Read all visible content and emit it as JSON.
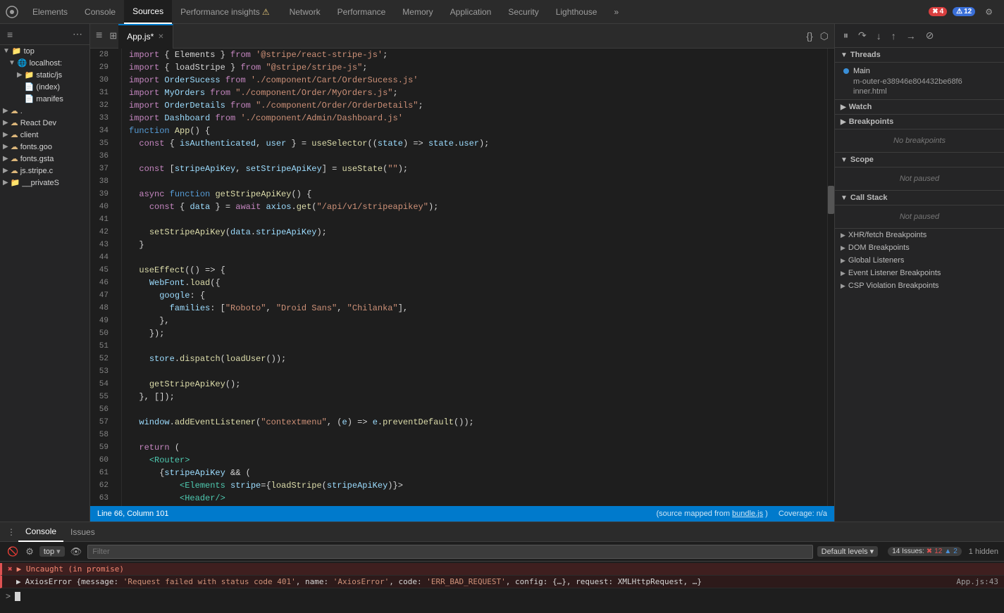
{
  "topnav": {
    "items": [
      {
        "label": "Elements",
        "active": false,
        "badge": null
      },
      {
        "label": "Console",
        "active": false,
        "badge": null
      },
      {
        "label": "Sources",
        "active": true,
        "badge": null
      },
      {
        "label": "Performance insights",
        "active": false,
        "badge": "warning",
        "icon": "⚠"
      },
      {
        "label": "Network",
        "active": false,
        "badge": null
      },
      {
        "label": "Performance",
        "active": false,
        "badge": null
      },
      {
        "label": "Memory",
        "active": false,
        "badge": null
      },
      {
        "label": "Application",
        "active": false,
        "badge": null
      },
      {
        "label": "Security",
        "active": false,
        "badge": null
      },
      {
        "label": "Lighthouse",
        "active": false,
        "badge": null
      },
      {
        "label": "»",
        "active": false,
        "badge": null
      }
    ],
    "error_badge": "4",
    "warning_badge": "12"
  },
  "sidebar": {
    "items": [
      {
        "label": "top",
        "indent": 0,
        "type": "folder",
        "expanded": true
      },
      {
        "label": "localhost:",
        "indent": 1,
        "type": "folder",
        "expanded": true
      },
      {
        "label": "static/js",
        "indent": 2,
        "type": "folder",
        "expanded": false
      },
      {
        "label": "(index)",
        "indent": 2,
        "type": "file",
        "active": false
      },
      {
        "label": "manifes",
        "indent": 2,
        "type": "file",
        "active": false
      },
      {
        "label": ".",
        "indent": 0,
        "type": "folder",
        "expanded": false
      },
      {
        "label": "React Dev",
        "indent": 0,
        "type": "folder",
        "expanded": false
      },
      {
        "label": "client",
        "indent": 0,
        "type": "folder",
        "expanded": false
      },
      {
        "label": "fonts.goo",
        "indent": 0,
        "type": "folder",
        "expanded": false
      },
      {
        "label": "fonts.gsta",
        "indent": 0,
        "type": "folder",
        "expanded": false
      },
      {
        "label": "js.stripe.c",
        "indent": 0,
        "type": "folder",
        "expanded": false
      },
      {
        "label": "__privateS",
        "indent": 0,
        "type": "folder",
        "expanded": false
      }
    ]
  },
  "editor": {
    "tabs": [
      {
        "label": "App.js*",
        "active": true,
        "modified": true
      }
    ],
    "lines": [
      {
        "num": 28,
        "code": "import { Elements } from '@stripe/react-stripe-js';",
        "tokens": [
          {
            "t": "kw",
            "v": "import"
          },
          {
            "t": "punct",
            "v": " { Elements } "
          },
          {
            "t": "kw",
            "v": "from"
          },
          {
            "t": "punct",
            "v": " "
          },
          {
            "t": "str",
            "v": "'@stripe/react-stripe-js'"
          },
          {
            "t": "punct",
            "v": ";"
          }
        ]
      },
      {
        "num": 29,
        "code": "import { loadStripe } from \"@stripe/stripe-js\";"
      },
      {
        "num": 30,
        "code": "import OrderSucess from './component/Cart/OrderSucess.js'"
      },
      {
        "num": 31,
        "code": "import MyOrders from \"./component/Order/MyOrders.js\";"
      },
      {
        "num": 32,
        "code": "import OrderDetails from \"./component/Order/OrderDetails\";"
      },
      {
        "num": 33,
        "code": "import Dashboard from './component/Admin/Dashboard.js'"
      },
      {
        "num": 34,
        "code": "function App() {"
      },
      {
        "num": 35,
        "code": "  const { isAuthenticated, user } = useSelector((state) => state.user);"
      },
      {
        "num": 36,
        "code": ""
      },
      {
        "num": 37,
        "code": "  const [stripeApiKey, setStripeApiKey] = useState(\"\");"
      },
      {
        "num": 38,
        "code": ""
      },
      {
        "num": 39,
        "code": "  async function getStripeApiKey() {"
      },
      {
        "num": 40,
        "code": "    const { data } = await axios.get(\"/api/v1/stripeapikey\");"
      },
      {
        "num": 41,
        "code": ""
      },
      {
        "num": 42,
        "code": "    setStripeApiKey(data.stripeApiKey);"
      },
      {
        "num": 43,
        "code": "  }"
      },
      {
        "num": 44,
        "code": ""
      },
      {
        "num": 45,
        "code": "  useEffect(() => {"
      },
      {
        "num": 46,
        "code": "    WebFont.load({"
      },
      {
        "num": 47,
        "code": "      google: {"
      },
      {
        "num": 48,
        "code": "        families: [\"Roboto\", \"Droid Sans\", \"Chilanka\"],"
      },
      {
        "num": 49,
        "code": "      },"
      },
      {
        "num": 50,
        "code": "    });"
      },
      {
        "num": 51,
        "code": ""
      },
      {
        "num": 52,
        "code": "    store.dispatch(loadUser());"
      },
      {
        "num": 53,
        "code": ""
      },
      {
        "num": 54,
        "code": "    getStripeApiKey();"
      },
      {
        "num": 55,
        "code": "  }, []);"
      },
      {
        "num": 56,
        "code": ""
      },
      {
        "num": 57,
        "code": "  window.addEventListener(\"contextmenu\", (e) => e.preventDefault());"
      },
      {
        "num": 58,
        "code": ""
      },
      {
        "num": 59,
        "code": "  return ("
      },
      {
        "num": 60,
        "code": "    <Router>"
      },
      {
        "num": 61,
        "code": "      {stripeApiKey && ("
      },
      {
        "num": 62,
        "code": "          <Elements stripe={loadStripe(stripeApiKey)}>"
      },
      {
        "num": 63,
        "code": "          <Header/>"
      }
    ],
    "status": {
      "line_col": "Line 66, Column 101",
      "source_map": "(source mapped from bundle.js)",
      "coverage": "Coverage: n/a"
    }
  },
  "right_panel": {
    "threads": {
      "label": "Threads",
      "main_thread": "Main",
      "sub_items": [
        "m-outer-e38946e804432be68f6",
        "inner.html"
      ]
    },
    "watch": {
      "label": "Watch"
    },
    "breakpoints": {
      "label": "Breakpoints",
      "empty_text": "No breakpoints"
    },
    "scope": {
      "label": "Scope",
      "status": "Not paused"
    },
    "call_stack": {
      "label": "Call Stack",
      "status": "Not paused"
    },
    "xhr_breakpoints": "XHR/fetch Breakpoints",
    "dom_breakpoints": "DOM Breakpoints",
    "global_listeners": "Global Listeners",
    "event_listeners": "Event Listener Breakpoints",
    "csp_violation": "CSP Violation Breakpoints"
  },
  "console": {
    "tabs": [
      {
        "label": "Console",
        "active": true
      },
      {
        "label": "Issues",
        "active": false
      }
    ],
    "top_label": "top",
    "filter_placeholder": "Filter",
    "default_levels": "Default levels",
    "issues_count": "14 Issues:",
    "issues_red": "12",
    "issues_blue": "2",
    "issues_hidden": "1 hidden",
    "messages": [
      {
        "type": "error",
        "icon": "✖",
        "text": "▶ Uncaught (in promise)",
        "location": ""
      },
      {
        "type": "error-detail",
        "icon": "▶",
        "text": "AxiosError {message: 'Request failed with status code 401', name: 'AxiosError', code: 'ERR_BAD_REQUEST', config: {…}, request: XMLHttpRequest, …}",
        "location": "App.js:43"
      }
    ]
  }
}
